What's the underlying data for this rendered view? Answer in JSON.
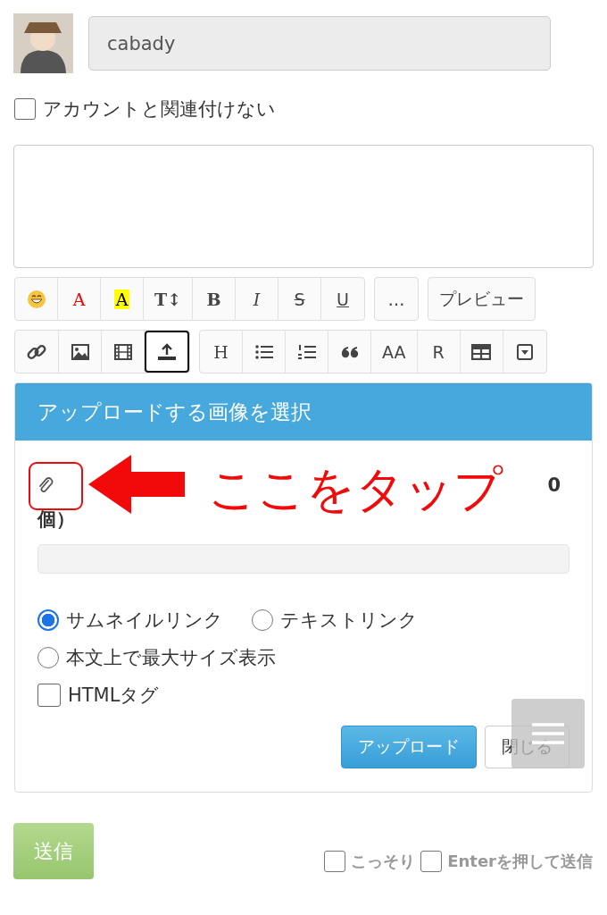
{
  "user": {
    "name": "cabady"
  },
  "anonymous_option": {
    "label": "アカウントと関連付けない",
    "checked": false
  },
  "toolbar_rows": [
    [
      {
        "buttons": [
          {
            "kind": "emoji",
            "selected": false
          },
          {
            "kind": "font-color",
            "label": "A",
            "selected": false
          },
          {
            "kind": "highlight",
            "label": "A",
            "selected": false
          },
          {
            "kind": "size",
            "label": "T↕",
            "selected": false
          },
          {
            "kind": "bold",
            "label": "B",
            "selected": false
          },
          {
            "kind": "italic",
            "label": "I",
            "selected": false
          },
          {
            "kind": "strike",
            "label": "S",
            "selected": false
          },
          {
            "kind": "underline",
            "label": "U",
            "selected": false
          }
        ]
      },
      {
        "buttons": [
          {
            "kind": "text",
            "label": "…",
            "selected": false
          }
        ]
      },
      {
        "buttons": [
          {
            "kind": "text",
            "label": "プレビュー",
            "selected": false
          }
        ]
      }
    ],
    [
      {
        "buttons": [
          {
            "kind": "link",
            "selected": false
          },
          {
            "kind": "image",
            "selected": false
          },
          {
            "kind": "film",
            "selected": false
          },
          {
            "kind": "upload",
            "selected": true
          }
        ]
      },
      {
        "buttons": [
          {
            "kind": "heading",
            "label": "H",
            "selected": false
          },
          {
            "kind": "bullet-list",
            "selected": false
          },
          {
            "kind": "number-list",
            "selected": false
          },
          {
            "kind": "quote",
            "selected": false
          },
          {
            "kind": "text",
            "label": "AA",
            "selected": false
          },
          {
            "kind": "text",
            "label": "R",
            "selected": false
          },
          {
            "kind": "table",
            "selected": false
          },
          {
            "kind": "dropdown",
            "selected": false
          }
        ]
      }
    ]
  ],
  "upload_dialog": {
    "title": "アップロードする画像を選択",
    "label_fragment": "0",
    "label_line_2": "個）",
    "options": [
      {
        "kind": "radio",
        "label": "サムネイルリンク",
        "selected": true
      },
      {
        "kind": "radio",
        "label": "テキストリンク",
        "selected": false
      },
      {
        "kind": "radio",
        "label": "本文上で最大サイズ表示",
        "selected": false
      },
      {
        "kind": "checkbox",
        "label": "HTMLタグ",
        "checked": false
      }
    ],
    "buttons": [
      {
        "kind": "primary",
        "label": "アップロード"
      },
      {
        "kind": "default",
        "label": "閉じる"
      }
    ],
    "annotation": {
      "text": "ここをタップ"
    }
  },
  "footer": {
    "send_label": "送信",
    "options": [
      {
        "label": "こっそり",
        "checked": false
      },
      {
        "label": "Enterを押して送信",
        "checked": false
      }
    ]
  }
}
